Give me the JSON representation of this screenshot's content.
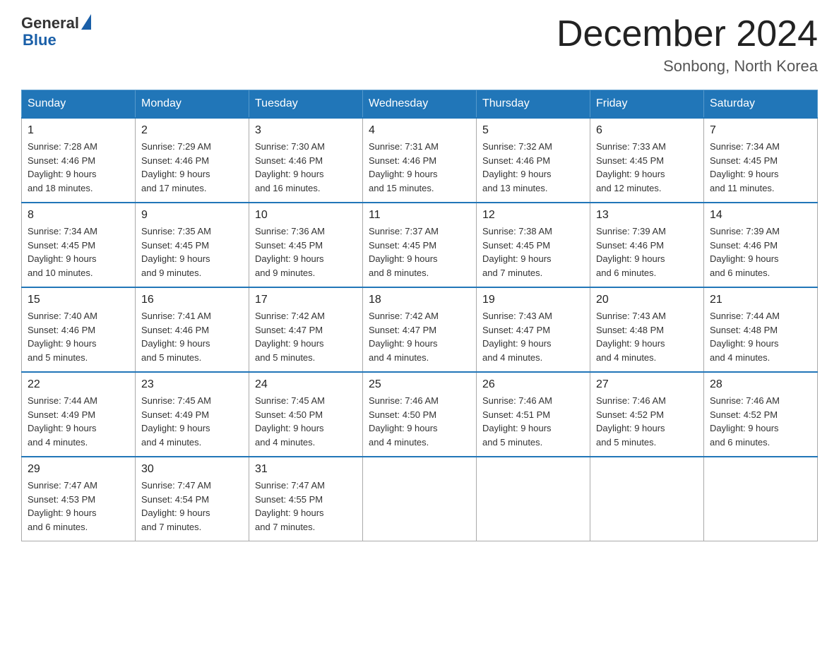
{
  "logo": {
    "general_text": "General",
    "blue_text": "Blue",
    "triangle_char": "▶"
  },
  "title": "December 2024",
  "subtitle": "Sonbong, North Korea",
  "days_of_week": [
    "Sunday",
    "Monday",
    "Tuesday",
    "Wednesday",
    "Thursday",
    "Friday",
    "Saturday"
  ],
  "weeks": [
    [
      {
        "day": "1",
        "sunrise": "7:28 AM",
        "sunset": "4:46 PM",
        "daylight": "9 hours and 18 minutes."
      },
      {
        "day": "2",
        "sunrise": "7:29 AM",
        "sunset": "4:46 PM",
        "daylight": "9 hours and 17 minutes."
      },
      {
        "day": "3",
        "sunrise": "7:30 AM",
        "sunset": "4:46 PM",
        "daylight": "9 hours and 16 minutes."
      },
      {
        "day": "4",
        "sunrise": "7:31 AM",
        "sunset": "4:46 PM",
        "daylight": "9 hours and 15 minutes."
      },
      {
        "day": "5",
        "sunrise": "7:32 AM",
        "sunset": "4:46 PM",
        "daylight": "9 hours and 13 minutes."
      },
      {
        "day": "6",
        "sunrise": "7:33 AM",
        "sunset": "4:45 PM",
        "daylight": "9 hours and 12 minutes."
      },
      {
        "day": "7",
        "sunrise": "7:34 AM",
        "sunset": "4:45 PM",
        "daylight": "9 hours and 11 minutes."
      }
    ],
    [
      {
        "day": "8",
        "sunrise": "7:34 AM",
        "sunset": "4:45 PM",
        "daylight": "9 hours and 10 minutes."
      },
      {
        "day": "9",
        "sunrise": "7:35 AM",
        "sunset": "4:45 PM",
        "daylight": "9 hours and 9 minutes."
      },
      {
        "day": "10",
        "sunrise": "7:36 AM",
        "sunset": "4:45 PM",
        "daylight": "9 hours and 9 minutes."
      },
      {
        "day": "11",
        "sunrise": "7:37 AM",
        "sunset": "4:45 PM",
        "daylight": "9 hours and 8 minutes."
      },
      {
        "day": "12",
        "sunrise": "7:38 AM",
        "sunset": "4:45 PM",
        "daylight": "9 hours and 7 minutes."
      },
      {
        "day": "13",
        "sunrise": "7:39 AM",
        "sunset": "4:46 PM",
        "daylight": "9 hours and 6 minutes."
      },
      {
        "day": "14",
        "sunrise": "7:39 AM",
        "sunset": "4:46 PM",
        "daylight": "9 hours and 6 minutes."
      }
    ],
    [
      {
        "day": "15",
        "sunrise": "7:40 AM",
        "sunset": "4:46 PM",
        "daylight": "9 hours and 5 minutes."
      },
      {
        "day": "16",
        "sunrise": "7:41 AM",
        "sunset": "4:46 PM",
        "daylight": "9 hours and 5 minutes."
      },
      {
        "day": "17",
        "sunrise": "7:42 AM",
        "sunset": "4:47 PM",
        "daylight": "9 hours and 5 minutes."
      },
      {
        "day": "18",
        "sunrise": "7:42 AM",
        "sunset": "4:47 PM",
        "daylight": "9 hours and 4 minutes."
      },
      {
        "day": "19",
        "sunrise": "7:43 AM",
        "sunset": "4:47 PM",
        "daylight": "9 hours and 4 minutes."
      },
      {
        "day": "20",
        "sunrise": "7:43 AM",
        "sunset": "4:48 PM",
        "daylight": "9 hours and 4 minutes."
      },
      {
        "day": "21",
        "sunrise": "7:44 AM",
        "sunset": "4:48 PM",
        "daylight": "9 hours and 4 minutes."
      }
    ],
    [
      {
        "day": "22",
        "sunrise": "7:44 AM",
        "sunset": "4:49 PM",
        "daylight": "9 hours and 4 minutes."
      },
      {
        "day": "23",
        "sunrise": "7:45 AM",
        "sunset": "4:49 PM",
        "daylight": "9 hours and 4 minutes."
      },
      {
        "day": "24",
        "sunrise": "7:45 AM",
        "sunset": "4:50 PM",
        "daylight": "9 hours and 4 minutes."
      },
      {
        "day": "25",
        "sunrise": "7:46 AM",
        "sunset": "4:50 PM",
        "daylight": "9 hours and 4 minutes."
      },
      {
        "day": "26",
        "sunrise": "7:46 AM",
        "sunset": "4:51 PM",
        "daylight": "9 hours and 5 minutes."
      },
      {
        "day": "27",
        "sunrise": "7:46 AM",
        "sunset": "4:52 PM",
        "daylight": "9 hours and 5 minutes."
      },
      {
        "day": "28",
        "sunrise": "7:46 AM",
        "sunset": "4:52 PM",
        "daylight": "9 hours and 6 minutes."
      }
    ],
    [
      {
        "day": "29",
        "sunrise": "7:47 AM",
        "sunset": "4:53 PM",
        "daylight": "9 hours and 6 minutes."
      },
      {
        "day": "30",
        "sunrise": "7:47 AM",
        "sunset": "4:54 PM",
        "daylight": "9 hours and 7 minutes."
      },
      {
        "day": "31",
        "sunrise": "7:47 AM",
        "sunset": "4:55 PM",
        "daylight": "9 hours and 7 minutes."
      },
      null,
      null,
      null,
      null
    ]
  ],
  "labels": {
    "sunrise": "Sunrise:",
    "sunset": "Sunset:",
    "daylight": "Daylight:"
  }
}
